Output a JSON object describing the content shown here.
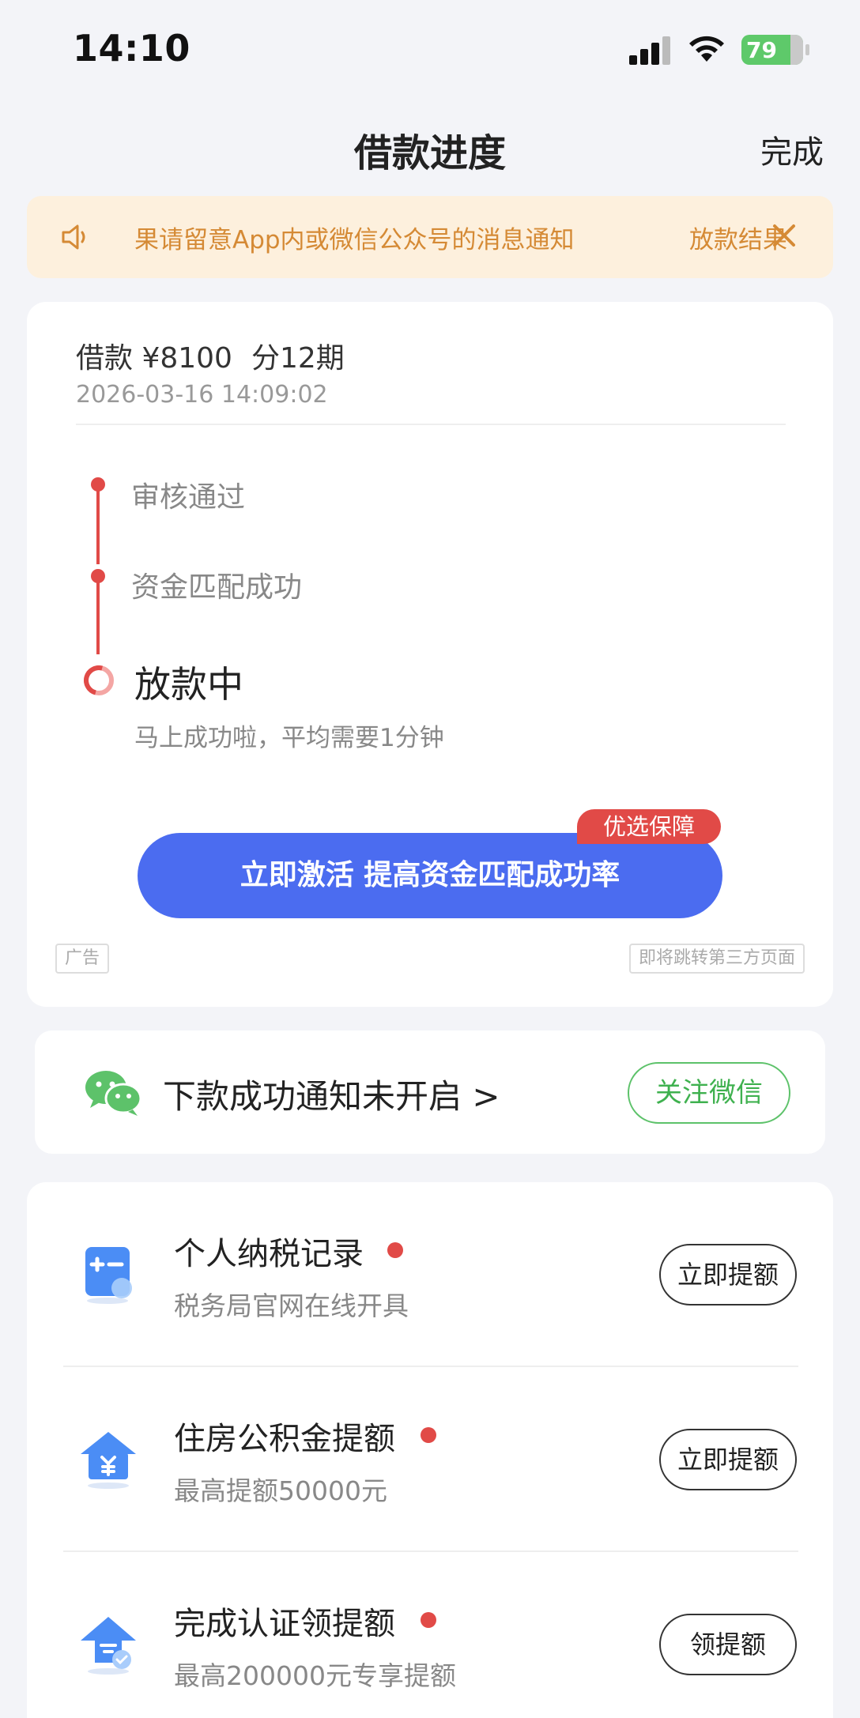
{
  "status_bar": {
    "time": "14:10",
    "battery": "79"
  },
  "nav": {
    "title": "借款进度",
    "done": "完成"
  },
  "notice": {
    "text": "果请留意App内或微信公众号的消息通知",
    "text_repeat": "放款结果"
  },
  "progress": {
    "summary_loan": "借款 ¥8100",
    "summary_terms": "分12期",
    "date": "2026-03-16 14:09:02",
    "steps": [
      {
        "label": "审核通过"
      },
      {
        "label": "资金匹配成功"
      }
    ],
    "current_step": "放款中",
    "current_sub": "马上成功啦，平均需要1分钟",
    "activate_button": "立即激活 提高资金匹配成功率",
    "badge": "优选保障",
    "ad_tag": "广告",
    "third_party_note": "即将跳转第三方页面"
  },
  "wechat": {
    "text": "下款成功通知未开启 >",
    "follow_button": "关注微信"
  },
  "list": {
    "items": [
      {
        "title": "个人纳税记录",
        "sub": "税务局官网在线开具",
        "button": "立即提额",
        "icon": "tax-calculator-icon"
      },
      {
        "title": "住房公积金提额",
        "sub": "最高提额50000元",
        "button": "立即提额",
        "icon": "housing-fund-icon"
      },
      {
        "title": "完成认证领提额",
        "sub": "最高200000元专享提额",
        "button": "领提额",
        "icon": "verify-upgrade-icon"
      }
    ]
  },
  "colors": {
    "accent_blue": "#4b6cf0",
    "accent_red": "#e14a47",
    "notice_bg": "#fdf0dd",
    "notice_text": "#d58a35",
    "wechat_green": "#3fb14f",
    "battery_green": "#5ec96a"
  }
}
